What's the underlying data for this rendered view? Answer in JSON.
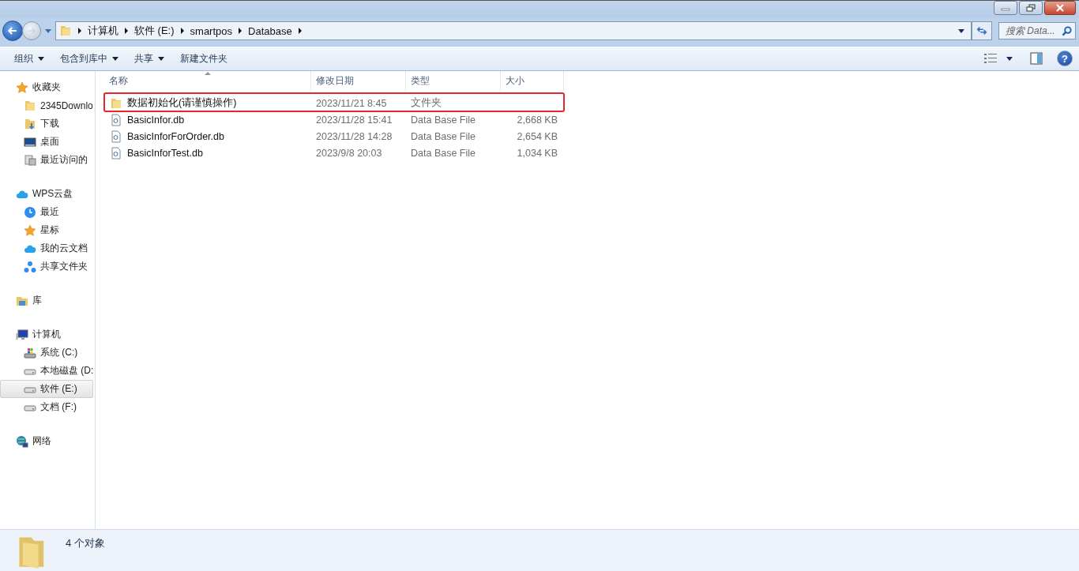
{
  "address_bar": {
    "segments": [
      "计算机",
      "软件 (E:)",
      "smartpos",
      "Database"
    ]
  },
  "search": {
    "placeholder": "搜索 Data..."
  },
  "toolbar": {
    "buttons": [
      {
        "label": "组织",
        "has_menu": true
      },
      {
        "label": "包含到库中",
        "has_menu": true
      },
      {
        "label": "共享",
        "has_menu": true
      },
      {
        "label": "新建文件夹",
        "has_menu": false
      }
    ],
    "help_glyph": "?"
  },
  "sidebar": {
    "groups": [
      {
        "label": "收藏夹",
        "kind": "star",
        "selected": false,
        "children": [
          {
            "label": "2345Downlo",
            "kind": "folder",
            "selected": false
          },
          {
            "label": "下载",
            "kind": "download",
            "selected": false
          },
          {
            "label": "桌面",
            "kind": "desktop",
            "selected": false
          },
          {
            "label": "最近访问的",
            "kind": "recent",
            "selected": false
          }
        ]
      },
      {
        "label": "WPS云盘",
        "kind": "cloud",
        "selected": false,
        "children": [
          {
            "label": "最近",
            "kind": "clock",
            "selected": false
          },
          {
            "label": "星标",
            "kind": "star",
            "selected": false
          },
          {
            "label": "我的云文档",
            "kind": "cloud",
            "selected": false
          },
          {
            "label": "共享文件夹",
            "kind": "share",
            "selected": false
          }
        ]
      },
      {
        "label": "库",
        "kind": "library",
        "selected": false
      },
      {
        "label": "计算机",
        "kind": "computer",
        "selected": false,
        "children": [
          {
            "label": "系统 (C:)",
            "kind": "sysdrive",
            "selected": false
          },
          {
            "label": "本地磁盘 (D:",
            "kind": "drive",
            "selected": false
          },
          {
            "label": "软件 (E:)",
            "kind": "drive",
            "selected": true
          },
          {
            "label": "文档 (F:)",
            "kind": "drive",
            "selected": false
          }
        ]
      },
      {
        "label": "网络",
        "kind": "network",
        "selected": false
      }
    ]
  },
  "file_list": {
    "columns": [
      "名称",
      "修改日期",
      "类型",
      "大小"
    ],
    "rows": [
      {
        "kind": "folder",
        "name": "数据初始化(请谨慎操作)",
        "date": "2023/11/21 8:45",
        "type": "文件夹",
        "highlighted": true
      },
      {
        "kind": "file",
        "name": "BasicInfor.db",
        "date": "2023/11/28 15:41",
        "type": "Data Base File",
        "size": "2,668 KB",
        "highlighted": false
      },
      {
        "kind": "file",
        "name": "BasicInforForOrder.db",
        "date": "2023/11/28 14:28",
        "type": "Data Base File",
        "size": "2,654 KB",
        "highlighted": false
      },
      {
        "kind": "file",
        "name": "BasicInforTest.db",
        "date": "2023/9/8 20:03",
        "type": "Data Base File",
        "size": "1,034 KB",
        "highlighted": false
      }
    ]
  },
  "status_bar": {
    "text": "4 个对象"
  }
}
